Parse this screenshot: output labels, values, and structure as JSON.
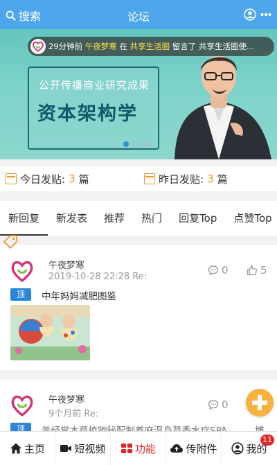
{
  "header": {
    "search_label": "搜索",
    "title": "论坛",
    "accent_color": "#4ea7ec"
  },
  "banner": {
    "ticker": {
      "time": "29分钟前",
      "user": "午夜梦寒",
      "prep": "在",
      "forum": "共享生活圈",
      "action": "留言了",
      "text": "共享生活圈使..."
    },
    "line1": "公开传播商业研究成果",
    "line2": "资本架构学",
    "slide_count": 3,
    "active_slide": 1
  },
  "stats": {
    "today": {
      "label": "今日发贴:",
      "value": "3",
      "unit": "篇"
    },
    "yesterday": {
      "label": "昨日发贴:",
      "value": "3",
      "unit": "篇"
    }
  },
  "tabs": [
    {
      "label": "新回复",
      "active": true
    },
    {
      "label": "新发表",
      "active": false
    },
    {
      "label": "推荐",
      "active": false
    },
    {
      "label": "热门",
      "active": false
    },
    {
      "label": "回复Top",
      "active": false
    },
    {
      "label": "点赞Top",
      "active": false
    }
  ],
  "posts": [
    {
      "user": "午夜梦寒",
      "time": "2019-10-28 22:28 Re:",
      "comments": "0",
      "likes": "5",
      "badge": "顶",
      "title": "中年妈妈减肥图鉴"
    },
    {
      "user": "午夜梦寒",
      "time": "9个月前 Re:",
      "comments": "0",
      "badge": "顶",
      "title": "美经堂本草植物秘配制养麻温身草香水疗SPA",
      "title_tail": "博"
    }
  ],
  "bottom_nav": [
    {
      "label": "主页",
      "icon": "home-icon",
      "active": false
    },
    {
      "label": "短视频",
      "icon": "video-camera-icon",
      "active": false
    },
    {
      "label": "功能",
      "icon": "grid-icon",
      "active": true
    },
    {
      "label": "传附件",
      "icon": "cloud-upload-icon",
      "active": false
    },
    {
      "label": "我的",
      "icon": "user-circle-icon",
      "active": false,
      "badge": "11"
    }
  ],
  "colors": {
    "active_nav": "#e02a2a",
    "highlight": "#f29322",
    "badge_blue": "#2a86d9",
    "fab": "#f6b23d"
  }
}
